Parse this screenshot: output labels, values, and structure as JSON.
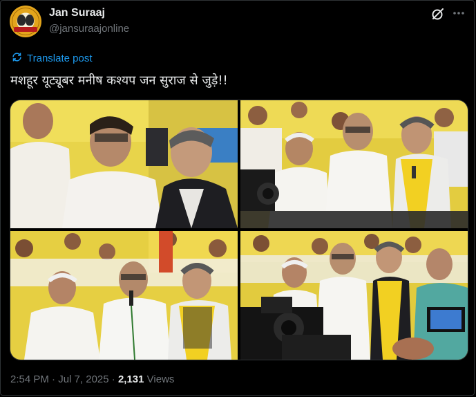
{
  "author": {
    "name": "Jan Suraaj",
    "handle": "@jansuraajonline"
  },
  "actions": {
    "grok_icon": "slashed-circle-icon",
    "more_icon": "more-horizontal-icon"
  },
  "translate": {
    "label": "Translate post",
    "icon": "translate-icon"
  },
  "post": {
    "text": "मशहूर यूट्यूबर मनीष कश्यप जन सुराज से जुड़े!!"
  },
  "media": {
    "photos": [
      {
        "id": "photo-1"
      },
      {
        "id": "photo-2"
      },
      {
        "id": "photo-3"
      },
      {
        "id": "photo-4"
      }
    ]
  },
  "meta": {
    "time": "2:54 PM",
    "date": "Jul 7, 2025",
    "separator": "·",
    "views_count": "2,131",
    "views_label": "Views"
  },
  "colors": {
    "background": "#000000",
    "text": "#e7e9ea",
    "muted": "#71767b",
    "link": "#1d9bf0",
    "border": "#2f3336",
    "backdrop_yellow": "#e8cf3c",
    "scarf_yellow": "#f2d022"
  }
}
